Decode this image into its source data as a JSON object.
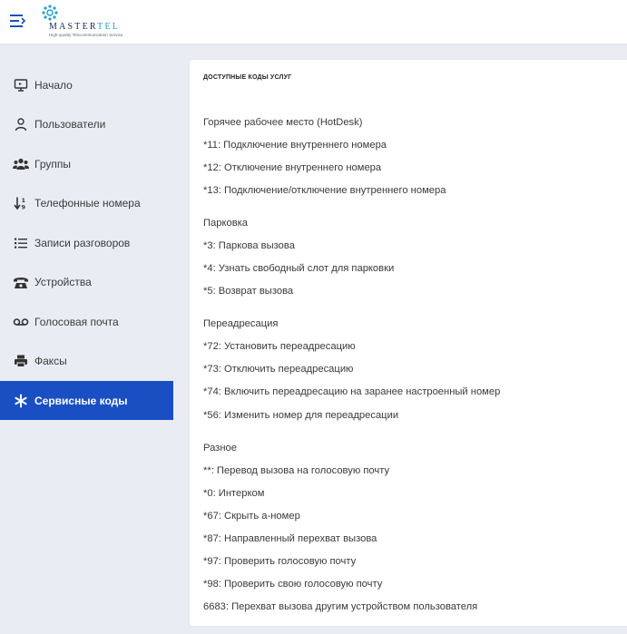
{
  "brand": {
    "name_main": "MASTER",
    "name_accent": "TEL",
    "tagline": "High-quality Telecommunication Service",
    "accent_color": "#1da1d8",
    "active_color": "#1a4fc4"
  },
  "sidebar": {
    "items": [
      {
        "label": "Начало",
        "icon": "monitor-icon"
      },
      {
        "label": "Пользователи",
        "icon": "user-icon"
      },
      {
        "label": "Группы",
        "icon": "users-icon"
      },
      {
        "label": "Телефонные номера",
        "icon": "sort-numeric-icon"
      },
      {
        "label": "Записи разговоров",
        "icon": "list-icon"
      },
      {
        "label": "Устройства",
        "icon": "phone-icon"
      },
      {
        "label": "Голосовая почта",
        "icon": "voicemail-icon"
      },
      {
        "label": "Факсы",
        "icon": "printer-icon"
      },
      {
        "label": "Сервисные коды",
        "icon": "asterisk-icon",
        "active": true
      }
    ]
  },
  "main": {
    "title": "доступные коды услуг",
    "rows": [
      "Горячее рабочее место (HotDesk)",
      "*11: Подключение внутреннего номера",
      "*12: Отключение внутреннего номера",
      "*13: Подключение/отключение внутреннего номера",
      "Парковка",
      "*3: Паркова вызова",
      "*4: Узнать свободный слот для парковки",
      "*5: Возврат вызова",
      "Переадресация",
      "*72: Установить переадресацию",
      "*73: Отключить переадресацию",
      "*74: Включить переадресацию на заранее настроенный номер",
      "*56: Изменить номер для переадресации",
      "Разное",
      "**: Перевод вызова на голосовую почту",
      "*0: Интерком",
      "*67: Скрыть а-номер",
      "*87: Направленный перехват вызова",
      "*97: Проверить голосовую почту",
      "*98: Проверить свою голосовую почту",
      "6683: Перехват вызова другим устройством пользователя"
    ]
  }
}
